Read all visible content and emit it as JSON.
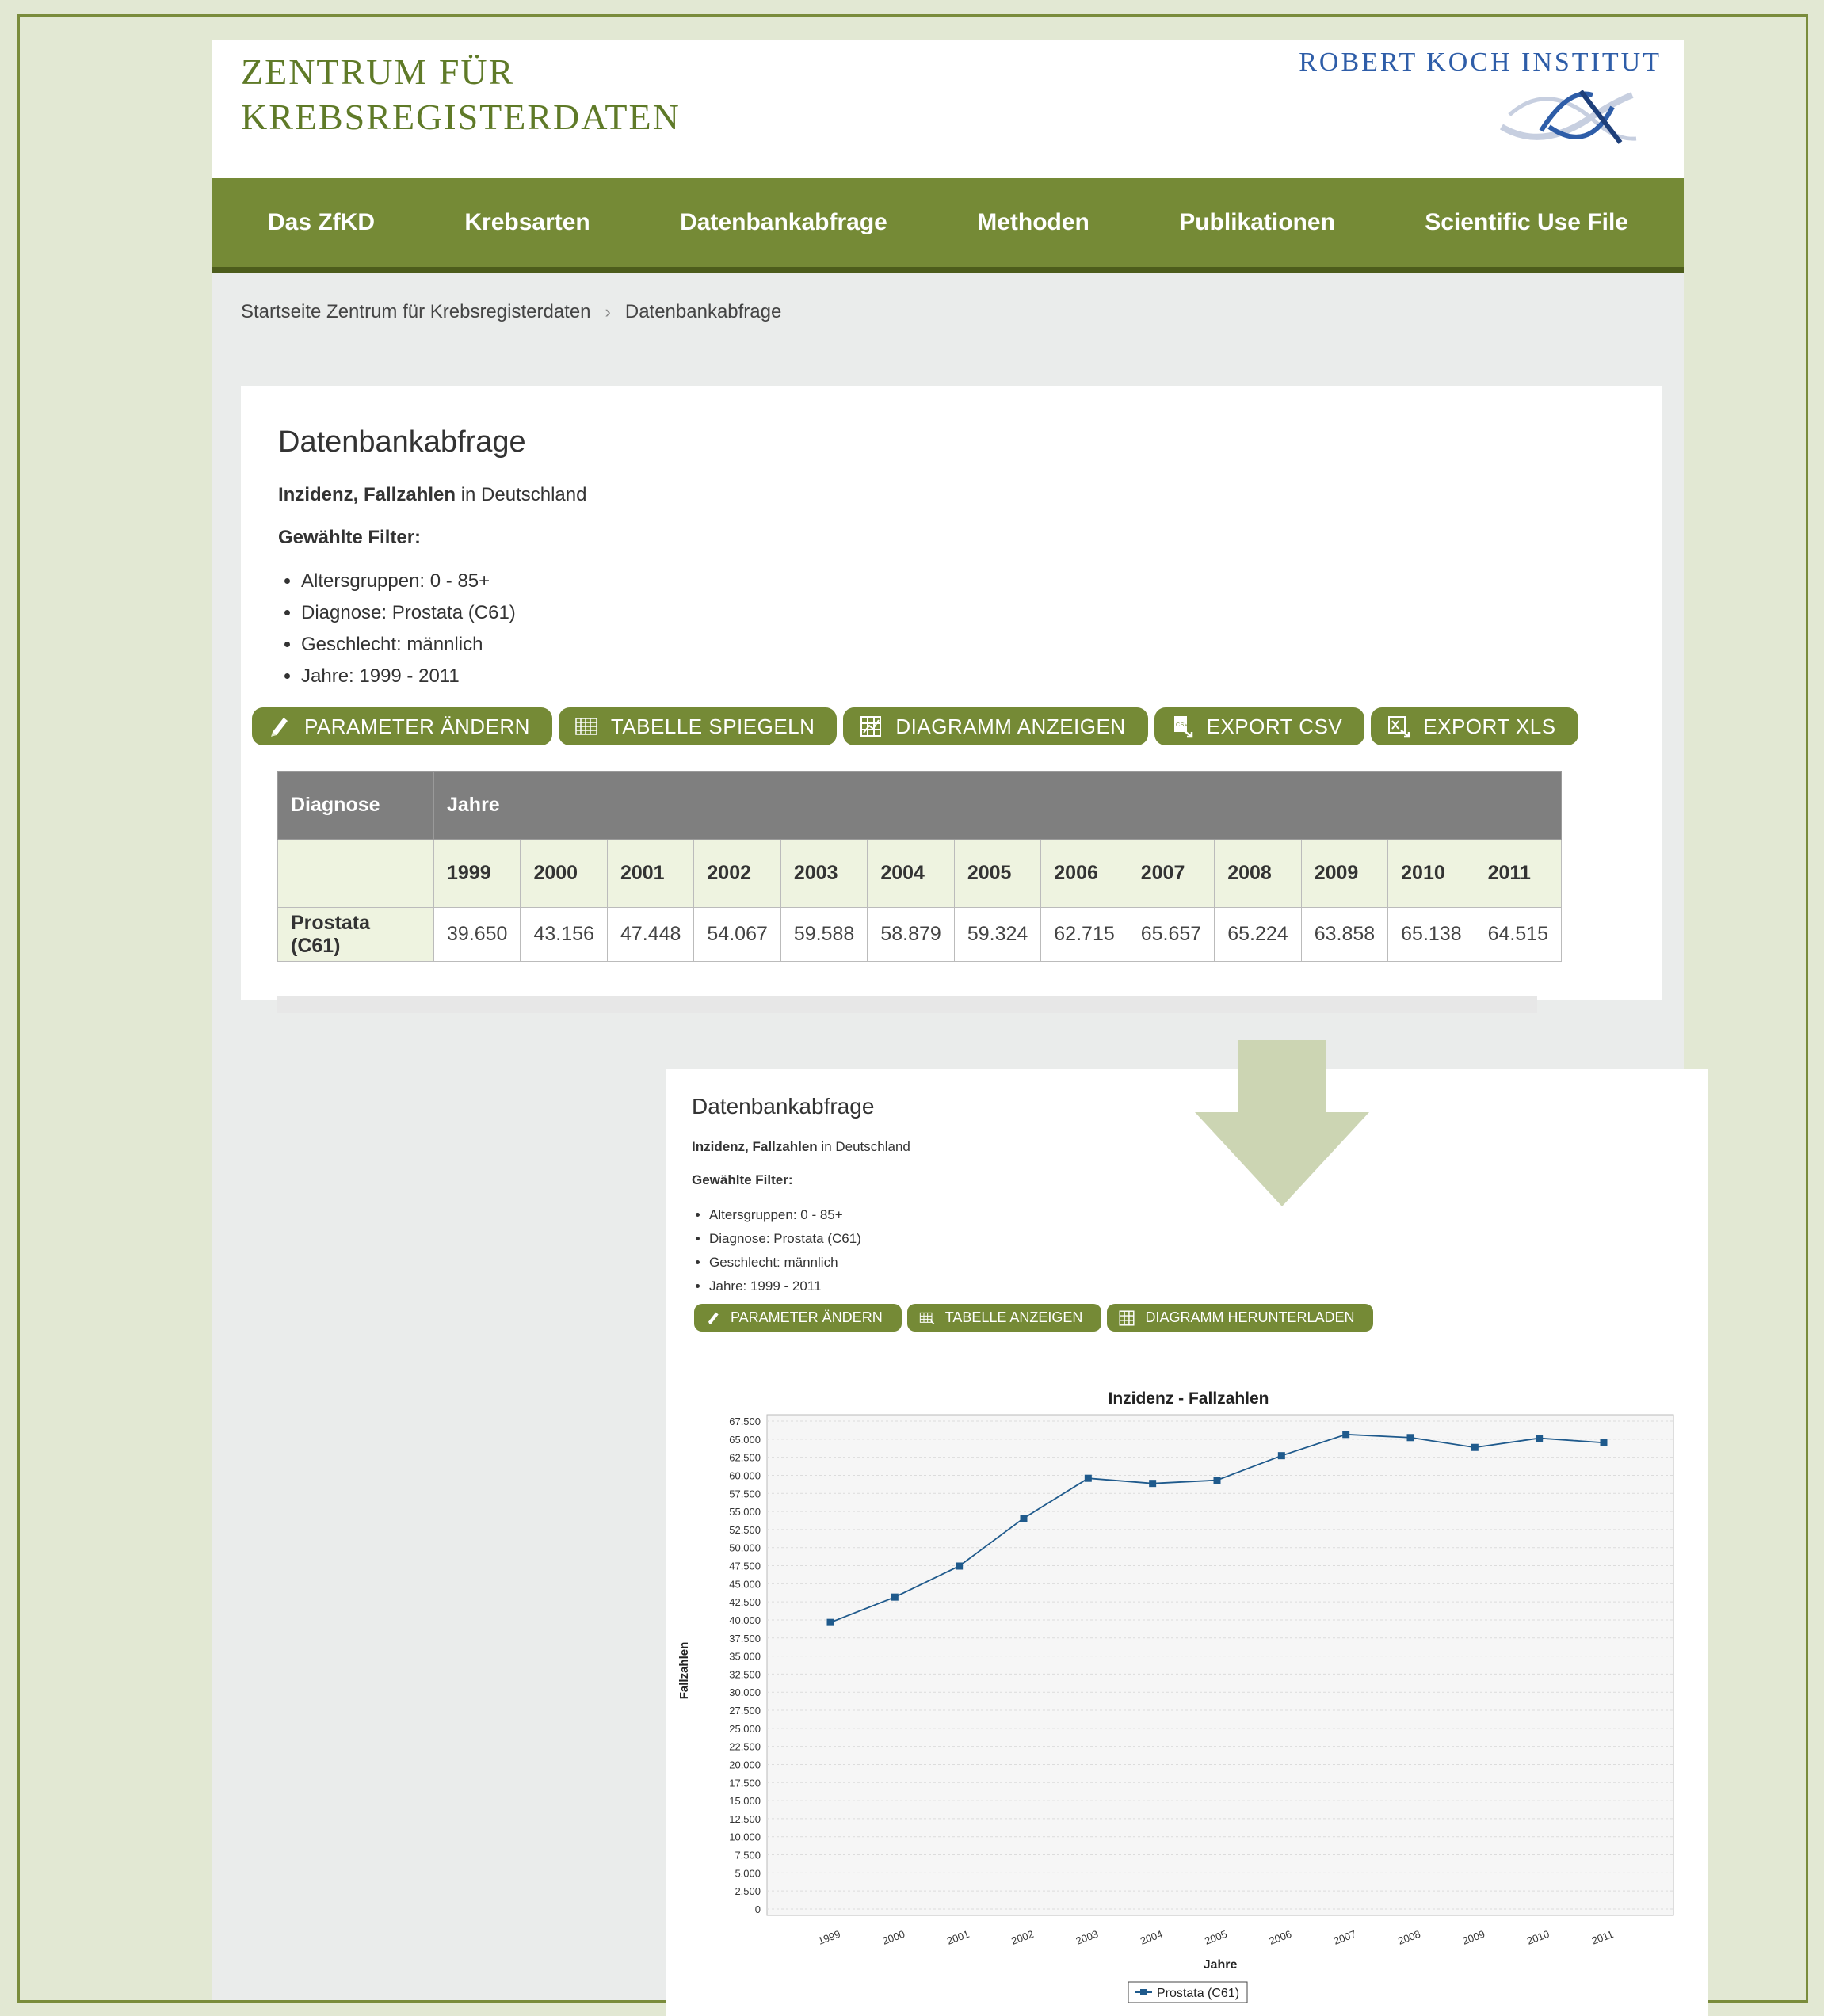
{
  "header": {
    "logo_line1": "ZENTRUM FÜR",
    "logo_line2": "KREBSREGISTERDATEN",
    "rki": "ROBERT KOCH INSTITUT"
  },
  "nav": [
    "Das ZfKD",
    "Krebsarten",
    "Datenbankabfrage",
    "Methoden",
    "Publikationen",
    "Scientific Use File"
  ],
  "breadcrumb": {
    "home": "Startseite Zentrum für Krebsregisterdaten",
    "sep": "›",
    "current": "Datenbankabfrage"
  },
  "query": {
    "title": "Datenbankabfrage",
    "subject_bold": "Inzidenz, Fallzahlen",
    "subject_rest": " in Deutschland",
    "filter_title": "Gewählte Filter:",
    "filters": [
      "Altersgruppen: 0 - 85+",
      "Diagnose: Prostata (C61)",
      "Geschlecht: männlich",
      "Jahre: 1999 - 2011"
    ]
  },
  "buttons": [
    "PARAMETER ÄNDERN",
    "TABELLE SPIEGELN",
    "DIAGRAMM ANZEIGEN",
    "EXPORT CSV",
    "EXPORT XLS"
  ],
  "table": {
    "col_diag": "Diagnose",
    "col_years": "Jahre",
    "years": [
      "1999",
      "2000",
      "2001",
      "2002",
      "2003",
      "2004",
      "2005",
      "2006",
      "2007",
      "2008",
      "2009",
      "2010",
      "2011"
    ],
    "row_label": "Prostata (C61)",
    "values": [
      "39.650",
      "43.156",
      "47.448",
      "54.067",
      "59.588",
      "58.879",
      "59.324",
      "62.715",
      "65.657",
      "65.224",
      "63.858",
      "65.138",
      "64.515"
    ]
  },
  "chart_view": {
    "title": "Datenbankabfrage",
    "subject_bold": "Inzidenz, Fallzahlen",
    "subject_rest": " in Deutschland",
    "filter_title": "Gewählte Filter:",
    "filters": [
      "Altersgruppen: 0 - 85+",
      "Diagnose: Prostata (C61)",
      "Geschlecht: männlich",
      "Jahre: 1999 - 2011"
    ],
    "buttons": [
      "PARAMETER ÄNDERN",
      "TABELLE ANZEIGEN",
      "DIAGRAMM HERUNTERLADEN"
    ]
  },
  "colors": {
    "green": "#758a36",
    "dark_green": "#4d5d1c",
    "series": "#1f5a8c",
    "arrow": "#ccd5b3"
  },
  "chart_data": {
    "type": "line",
    "title": "Inzidenz - Fallzahlen",
    "xlabel": "Jahre",
    "ylabel": "Fallzahlen",
    "ylim": [
      0,
      67500
    ],
    "yticks": [
      "0",
      "2.500",
      "5.000",
      "7.500",
      "10.000",
      "12.500",
      "15.000",
      "17.500",
      "20.000",
      "22.500",
      "25.000",
      "27.500",
      "30.000",
      "32.500",
      "35.000",
      "37.500",
      "40.000",
      "42.500",
      "45.000",
      "47.500",
      "50.000",
      "52.500",
      "55.000",
      "57.500",
      "60.000",
      "62.500",
      "65.000",
      "67.500"
    ],
    "x": [
      "1999",
      "2000",
      "2001",
      "2002",
      "2003",
      "2004",
      "2005",
      "2006",
      "2007",
      "2008",
      "2009",
      "2010",
      "2011"
    ],
    "series": [
      {
        "name": "Prostata (C61)",
        "values": [
          39650,
          43156,
          47448,
          54067,
          59588,
          58879,
          59324,
          62715,
          65657,
          65224,
          63858,
          65138,
          64515
        ]
      }
    ],
    "legend": "bottom-center",
    "grid": true
  }
}
